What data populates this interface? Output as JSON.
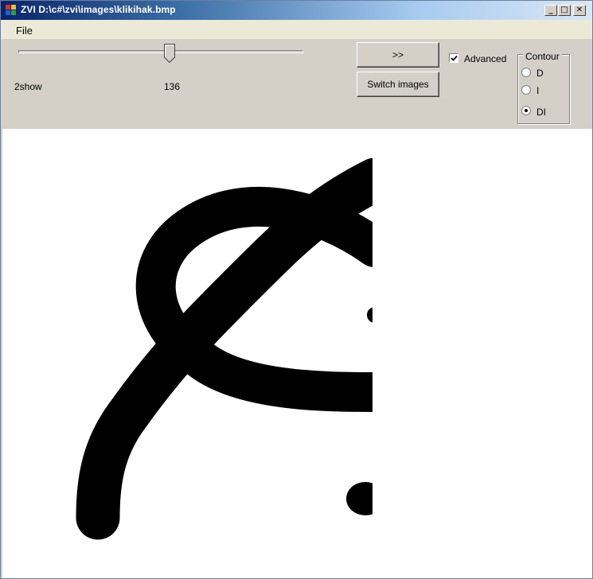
{
  "window": {
    "title": "ZVI D:\\c#\\zvi\\images\\klikihak.bmp",
    "buttons": {
      "minimize": "_",
      "maximize": "□",
      "close": "✕"
    }
  },
  "menu": {
    "file": "File"
  },
  "controls": {
    "slider": {
      "value": 136,
      "label": "136"
    },
    "show_label": "2show",
    "next_button": ">>",
    "switch_button": "Switch images",
    "advanced": {
      "label": "Advanced",
      "checked": true
    },
    "contour": {
      "title": "Contour",
      "options": [
        {
          "label": "D",
          "selected": false
        },
        {
          "label": "I",
          "selected": false
        },
        {
          "label": "DI",
          "selected": true
        }
      ]
    }
  },
  "colors": {
    "accent": "#0a246a",
    "face": "#d4d0c8",
    "ink": "#000000"
  }
}
